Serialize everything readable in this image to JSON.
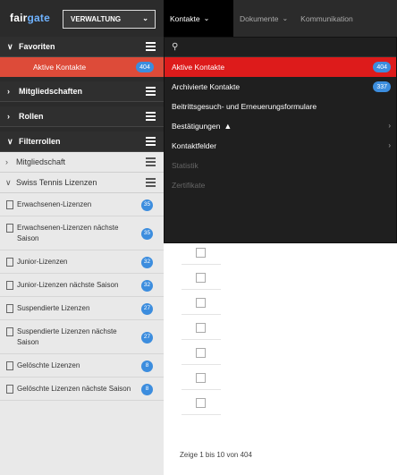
{
  "app": {
    "logo_main": "fair",
    "logo_accent": "gate",
    "admin_select": "VERWALTUNG"
  },
  "topnav": [
    {
      "label": "Kontakte",
      "active": true
    },
    {
      "label": "Dokumente",
      "active": false
    },
    {
      "label": "Kommunikation",
      "active": false
    }
  ],
  "sidebar": {
    "favoriten": {
      "title": "Favoriten",
      "items": [
        {
          "label": "Aktive Kontakte",
          "count": "404"
        }
      ]
    },
    "mitgliedschaften": {
      "title": "Mitgliedschaften"
    },
    "rollen": {
      "title": "Rollen"
    },
    "filterrollen": {
      "title": "Filterrollen"
    },
    "mitgliedschaft": {
      "title": "Mitgliedschaft"
    },
    "swiss": {
      "title": "Swiss Tennis Lizenzen"
    },
    "filters": [
      {
        "label": "Erwachsenen-Lizenzen",
        "count": "35"
      },
      {
        "label": "Erwachsenen-Lizenzen nächste Saison",
        "count": "35"
      },
      {
        "label": "Junior-Lizenzen",
        "count": "32"
      },
      {
        "label": "Junior-Lizenzen nächste Saison",
        "count": "32"
      },
      {
        "label": "Suspendierte Lizenzen",
        "count": "27"
      },
      {
        "label": "Suspendierte Lizenzen nächste Saison",
        "count": "27"
      },
      {
        "label": "Gelöschte Lizenzen",
        "count": "8"
      },
      {
        "label": "Gelöschte Lizenzen nächste Saison",
        "count": "8"
      }
    ]
  },
  "dropdown": {
    "search_icon": "search-icon",
    "items": [
      {
        "label": "Aktive Kontakte",
        "badge": "404",
        "active": true
      },
      {
        "label": "Archivierte Kontakte",
        "badge": "337"
      },
      {
        "label": "Beitrittsgesuch- und Erneuerungsformulare"
      },
      {
        "label": "Bestätigungen",
        "warning": "▲",
        "submenu": true
      },
      {
        "label": "Kontaktfelder",
        "submenu": true
      },
      {
        "label": "Statistik",
        "disabled": true
      },
      {
        "label": "Zertifikate",
        "disabled": true
      }
    ]
  },
  "table": {
    "footer": "Zeige 1 bis 10 von 404"
  },
  "colors": {
    "accent_red": "#dd4b39",
    "badge_blue": "#3c8dde",
    "topbar": "#2b2b2b"
  }
}
